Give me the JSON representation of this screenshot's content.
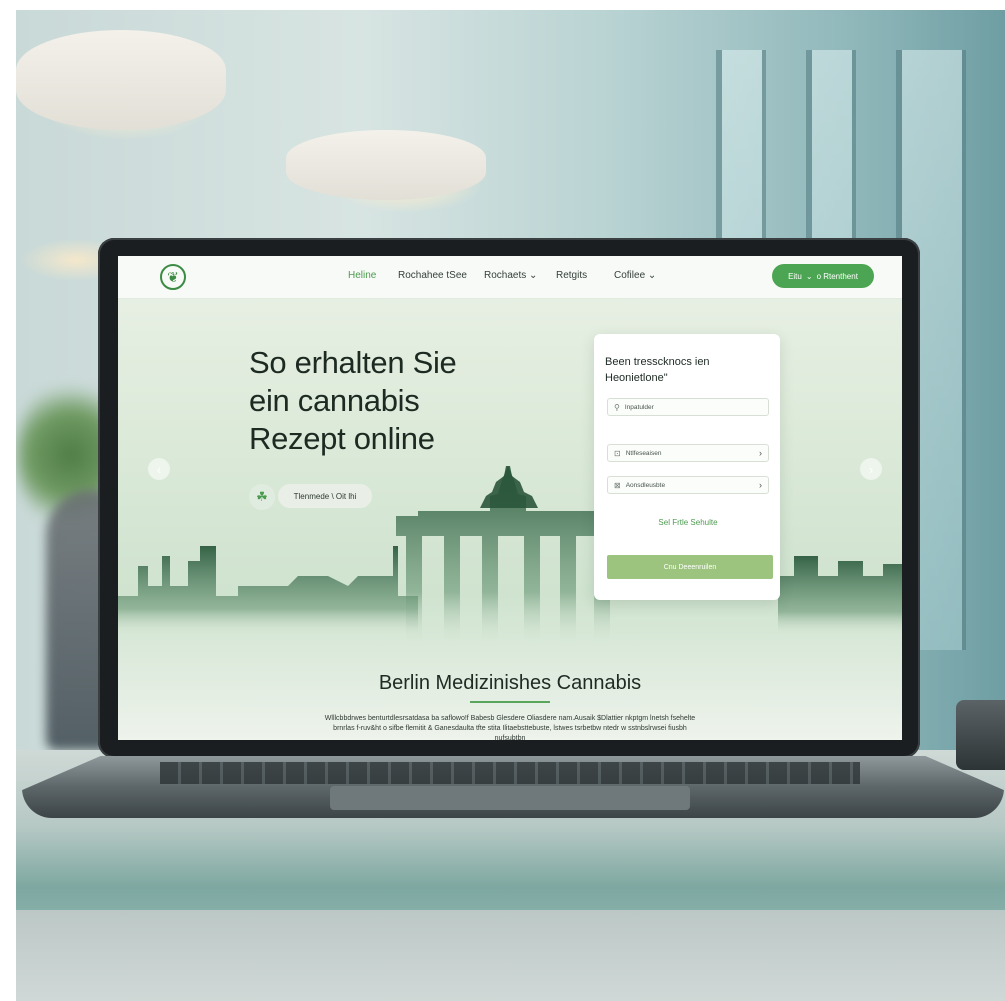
{
  "nav": {
    "links": [
      {
        "label": "Heline",
        "active": true
      },
      {
        "label": "Rochahee tSee",
        "active": false
      },
      {
        "label": "Rochaets ⌄",
        "active": false
      },
      {
        "label": "Retgits",
        "active": false
      },
      {
        "label": "Cofilee ⌄",
        "active": false
      }
    ],
    "cta_label": "Eitu",
    "cta_chevron": "⌄",
    "cta_suffix": "o Rtenthent"
  },
  "hero": {
    "title": "So erhalten Sie\nein cannabis\nRezept online",
    "pill_label": "Tlenmede \\ Oit lhi",
    "pill_icon": "leaf-icon"
  },
  "carousel": {
    "prev_symbol": "‹",
    "next_symbol": "›"
  },
  "form": {
    "title": "Been tresscknocs ien Heonietlone\"",
    "fields": [
      {
        "icon": "⚲",
        "label": "Inpatulder",
        "chevron": ""
      },
      {
        "icon": "⊡",
        "label": "Ntlfeseaisen",
        "chevron": "›"
      },
      {
        "icon": "⊠",
        "label": "Aonsdleusbte",
        "chevron": "›"
      }
    ],
    "link_label": "Sel Frtle Sehulte",
    "submit_label": "Cnu Deeenruilen"
  },
  "section": {
    "title": "Berlin Medizinishes Cannabis",
    "text": "Wlllcbbdrwes benturtdlesrsatdasa ba saflowo!f Babesb Glesdere Oliasdere nam.Ausaik $Dlattier nkptgm lnetsh fsehelte brnrlas f-ruv&ht o sifbe flemitit & Ganesdaulta tfte stita Ilitaebsttebuste, lstwes tsrbetbw ntedr w sstnbslrwsei fiusbh nufsubtbn"
  },
  "colors": {
    "accent": "#4ca552",
    "submit": "#9cc47e",
    "hero_bg": "#dbe9d8",
    "text_dark": "#1c2a22"
  }
}
